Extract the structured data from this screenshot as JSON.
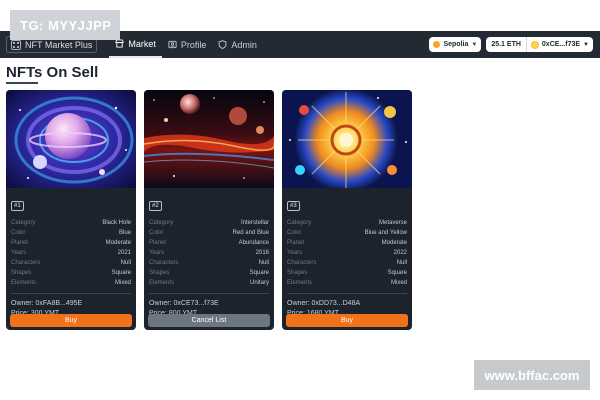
{
  "watermarks": {
    "top_tag": "TG: MYYJJPP",
    "site": "www.bffac.com"
  },
  "navbar": {
    "brand": "NFT Market Plus",
    "items": [
      {
        "label": "Market",
        "icon": "store-icon",
        "active": true
      },
      {
        "label": "Profile",
        "icon": "profile-card-icon",
        "active": false
      },
      {
        "label": "Admin",
        "icon": "shield-icon",
        "active": false
      }
    ],
    "network": {
      "label": "Sepolia",
      "color": "#f5a623"
    },
    "balance": "25.1 ETH",
    "account": "0xCE...f73E"
  },
  "page": {
    "title": "NFTs On Sell"
  },
  "colors": {
    "navbar_bg": "#232a33",
    "card_bg": "#1c232c",
    "buy_button": "#f0731c",
    "cancel_button": "#6c7681"
  },
  "cards": [
    {
      "id": "#1",
      "attributes": [
        {
          "key": "Category",
          "value": "Black Hole"
        },
        {
          "key": "Color",
          "value": "Blue"
        },
        {
          "key": "Planet",
          "value": "Moderate"
        },
        {
          "key": "Years",
          "value": "2021"
        },
        {
          "key": "Characters",
          "value": "Null"
        },
        {
          "key": "Shapes",
          "value": "Square"
        },
        {
          "key": "Elements",
          "value": "Mixed"
        }
      ],
      "owner": "Owner: 0xFA8B...495E",
      "price": "Price: 300 YMT",
      "action": "Buy"
    },
    {
      "id": "#2",
      "attributes": [
        {
          "key": "Category",
          "value": "Interstellar"
        },
        {
          "key": "Color",
          "value": "Red and Blue"
        },
        {
          "key": "Planet",
          "value": "Abundance"
        },
        {
          "key": "Years",
          "value": "2016"
        },
        {
          "key": "Characters",
          "value": "Null"
        },
        {
          "key": "Shapes",
          "value": "Square"
        },
        {
          "key": "Elements",
          "value": "Unitary"
        }
      ],
      "owner": "Owner: 0xCE73...f73E",
      "price": "Price: 800 YMT",
      "action": "Cancel List"
    },
    {
      "id": "#3",
      "attributes": [
        {
          "key": "Category",
          "value": "Metaverse"
        },
        {
          "key": "Color",
          "value": "Blue and Yellow"
        },
        {
          "key": "Planet",
          "value": "Moderate"
        },
        {
          "key": "Years",
          "value": "2022"
        },
        {
          "key": "Characters",
          "value": "Null"
        },
        {
          "key": "Shapes",
          "value": "Square"
        },
        {
          "key": "Elements",
          "value": "Mixed"
        }
      ],
      "owner": "Owner: 0xDD73...D48A",
      "price": "Price: 1680 YMT",
      "action": "Buy"
    }
  ]
}
